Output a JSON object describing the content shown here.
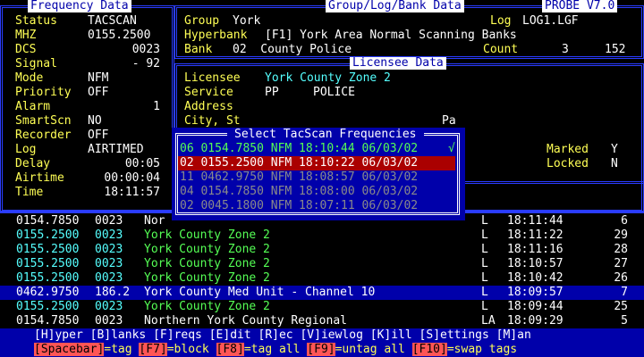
{
  "titles": {
    "freq": "Frequency Data",
    "group": "Group/Log/Bank Data",
    "probe": "PROBE V7.0",
    "licensee": "Licensee Data"
  },
  "freq": {
    "labels": [
      "Status",
      "MHZ",
      "DCS",
      "Signal",
      "Mode",
      "Priority",
      "Alarm",
      "SmartScn",
      "Recorder",
      "Log",
      "Delay",
      "Airtime",
      "Time"
    ],
    "values": [
      "TACSCAN",
      "0155.2500",
      "0023",
      "- 92",
      "NFM",
      "OFF",
      "1",
      "NO",
      "OFF",
      "AIRTIMED",
      "00:05",
      "00:00:04",
      "18:11:57"
    ]
  },
  "group": {
    "group_label": "Group",
    "group_value": "York",
    "log_label": "Log",
    "log_value": "LOG1.LGF",
    "hyperbank_label": "Hyperbank",
    "hyperbank_value": "[F1] York Area Normal Scanning Banks",
    "bank_label": "Bank",
    "bank_value": "02  County Police",
    "count_label": "Count",
    "count_a": "3",
    "count_b": "152"
  },
  "licensee": {
    "lic_label": "Licensee",
    "lic_value": "York County Zone 2",
    "service_label": "Service",
    "service_code": "PP",
    "service_value": "POLICE",
    "address_label": "Address",
    "city_label": "City, St",
    "state_value": "Pa",
    "marked_label": "Marked",
    "marked_value": "Y",
    "locked_label": "Locked",
    "locked_value": "N"
  },
  "dialog": {
    "title": "Select TacScan Frequencies",
    "rows": [
      {
        "text": "06 0154.7850 NFM 18:10:44 06/03/02",
        "check": "√"
      },
      {
        "text": "02 0155.2500 NFM 18:10:22 06/03/02",
        "check": ""
      },
      {
        "text": "11 0462.9750 NFM 18:08:57 06/03/02",
        "check": ""
      },
      {
        "text": "04 0154.7850 NFM 18:08:00 06/03/02",
        "check": ""
      },
      {
        "text": "02 0045.1800 NFM 18:07:11 06/03/02",
        "check": ""
      }
    ]
  },
  "log": {
    "rows": [
      {
        "freq": "0154.7850",
        "dcs": "0023",
        "name": "Nor",
        "flag": "L",
        "time": "18:11:44",
        "cnt": "6"
      },
      {
        "freq": "0155.2500",
        "dcs": "0023",
        "name": "York County Zone 2",
        "flag": "L",
        "time": "18:11:22",
        "cnt": "29"
      },
      {
        "freq": "0155.2500",
        "dcs": "0023",
        "name": "York County Zone 2",
        "flag": "L",
        "time": "18:11:16",
        "cnt": "28"
      },
      {
        "freq": "0155.2500",
        "dcs": "0023",
        "name": "York County Zone 2",
        "flag": "L",
        "time": "18:10:57",
        "cnt": "27"
      },
      {
        "freq": "0155.2500",
        "dcs": "0023",
        "name": "York County Zone 2",
        "flag": "L",
        "time": "18:10:42",
        "cnt": "26"
      },
      {
        "freq": "0462.9750",
        "dcs": "186.2",
        "name": "York County Med Unit - Channel 10",
        "flag": "L",
        "time": "18:09:57",
        "cnt": "7"
      },
      {
        "freq": "0155.2500",
        "dcs": "0023",
        "name": "York County Zone 2",
        "flag": "L",
        "time": "18:09:44",
        "cnt": "25"
      },
      {
        "freq": "0154.7850",
        "dcs": "0023",
        "name": "Northern York County Regional",
        "flag": "LA",
        "time": "18:09:29",
        "cnt": "5"
      }
    ]
  },
  "footer": {
    "line1": [
      {
        "k": "[H]",
        "t": "yper "
      },
      {
        "k": "[B]",
        "t": "lanks "
      },
      {
        "k": "[F]",
        "t": "reqs "
      },
      {
        "k": "[E]",
        "t": "dit "
      },
      {
        "k": "[R]",
        "t": "ec "
      },
      {
        "k": "[V]",
        "t": "iewlog "
      },
      {
        "k": "[K]",
        "t": "ill "
      },
      {
        "k": "[S]",
        "t": "ettings "
      },
      {
        "k": "[M]",
        "t": "an"
      }
    ],
    "line2": [
      {
        "k": "[Spacebar]",
        "t": "=tag "
      },
      {
        "k": "[F7]",
        "t": "=block "
      },
      {
        "k": "[F8]",
        "t": "=tag all "
      },
      {
        "k": "[F9]",
        "t": "=untag all "
      },
      {
        "k": "[F10]",
        "t": "=swap tags"
      }
    ]
  }
}
